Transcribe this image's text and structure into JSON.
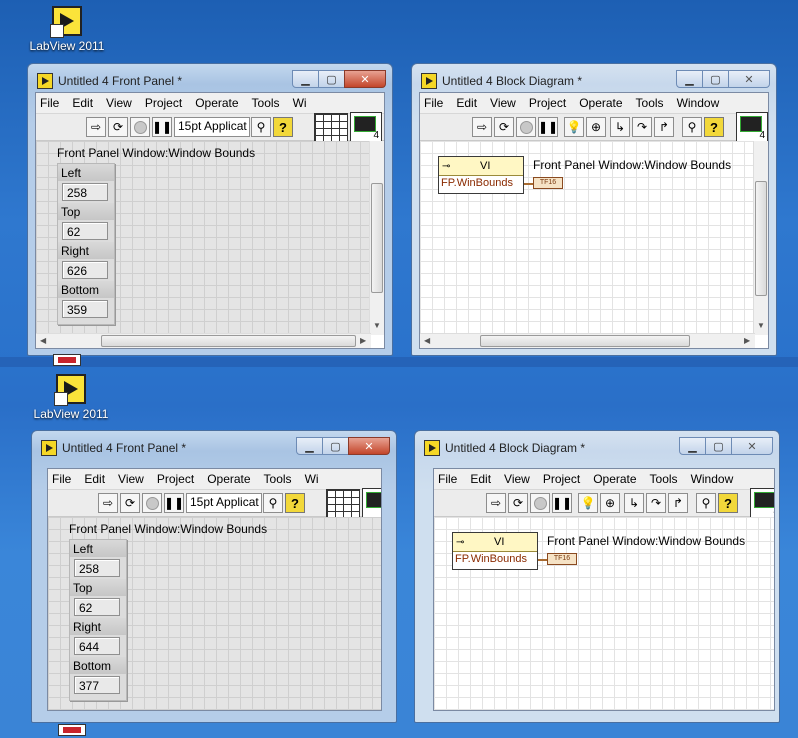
{
  "desktop": {
    "icon_label": "LabView 2011"
  },
  "front_panel": {
    "title": "Untitled 4 Front Panel *",
    "menu": [
      "File",
      "Edit",
      "View",
      "Project",
      "Operate",
      "Tools",
      "Wi"
    ],
    "font_select": "15pt Applicat",
    "cluster_label": "Front Panel Window:Window Bounds",
    "fields": {
      "left_label": "Left",
      "top_label": "Top",
      "right_label": "Right",
      "bottom_label": "Bottom"
    }
  },
  "block_diagram": {
    "title": "Untitled 4 Block Diagram *",
    "menu": [
      "File",
      "Edit",
      "View",
      "Project",
      "Operate",
      "Tools",
      "Window"
    ],
    "node_class": "VI",
    "node_property": "FP.WinBounds",
    "indicator_label": "Front Panel Window:Window Bounds",
    "indicator_type": "TF16"
  },
  "before": {
    "left": "258",
    "top": "62",
    "right": "626",
    "bottom": "359"
  },
  "after": {
    "left": "258",
    "top": "62",
    "right": "644",
    "bottom": "377"
  }
}
